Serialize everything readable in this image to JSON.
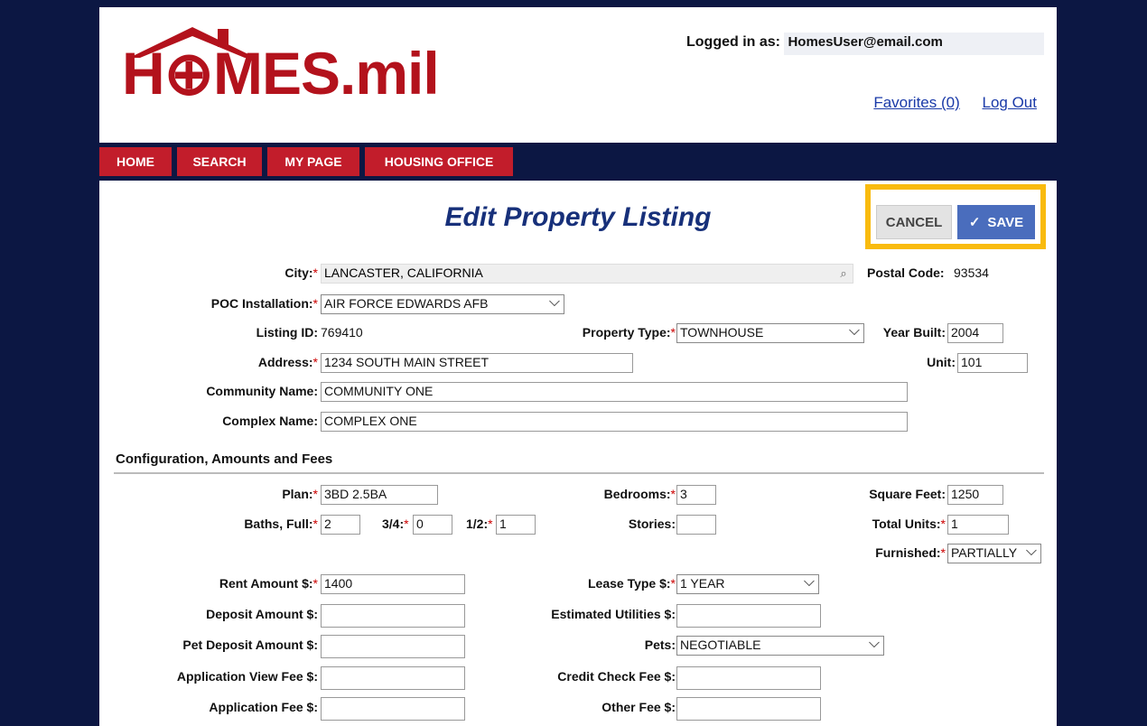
{
  "header": {
    "logo_text": "H⊕MES.mil",
    "logged_label": "Logged in as:",
    "user_email": "HomesUser@email.com",
    "favorites_link": "Favorites (0)",
    "logout_link": "Log Out"
  },
  "nav": [
    {
      "label": "HOME"
    },
    {
      "label": "SEARCH"
    },
    {
      "label": "MY PAGE"
    },
    {
      "label": "HOUSING OFFICE"
    }
  ],
  "page_title": "Edit Property Listing",
  "actions": {
    "cancel": "CANCEL",
    "save": "SAVE",
    "save_icon": "check-icon"
  },
  "form": {
    "city_label": "City:",
    "city_value": "LANCASTER, CALIFORNIA",
    "postal_label": "Postal Code:",
    "postal_value": "93534",
    "poc_label": "POC Installation:",
    "poc_value": "AIR FORCE EDWARDS AFB",
    "listing_label": "Listing ID:",
    "listing_value": "769410",
    "ptype_label": "Property Type:",
    "ptype_value": "TOWNHOUSE",
    "year_label": "Year Built:",
    "year_value": "2004",
    "address_label": "Address:",
    "address_value": "1234 SOUTH MAIN STREET",
    "unit_label": "Unit:",
    "unit_value": "101",
    "community_label": "Community Name:",
    "community_value": "COMMUNITY ONE",
    "complex_label": "Complex Name:",
    "complex_value": "COMPLEX ONE"
  },
  "config": {
    "section_title": "Configuration, Amounts and Fees",
    "plan_label": "Plan:",
    "plan_value": "3BD 2.5BA",
    "bedrooms_label": "Bedrooms:",
    "bedrooms_value": "3",
    "sqft_label": "Square Feet:",
    "sqft_value": "1250",
    "baths_label": "Baths, Full:",
    "baths_value": "2",
    "three_q_label": "3/4:",
    "three_q_value": "0",
    "half_label": "1/2:",
    "half_value": "1",
    "stories_label": "Stories:",
    "stories_value": "",
    "total_units_label": "Total Units:",
    "total_units_value": "1",
    "furnished_label": "Furnished:",
    "furnished_value": "PARTIALLY",
    "rent_label": "Rent Amount $:",
    "rent_value": "1400",
    "lease_label": "Lease Type $:",
    "lease_value": "1 YEAR",
    "deposit_label": "Deposit Amount $:",
    "deposit_value": "",
    "utilities_label": "Estimated Utilities $:",
    "utilities_value": "",
    "pet_deposit_label": "Pet Deposit Amount $:",
    "pet_deposit_value": "",
    "pets_label": "Pets:",
    "pets_value": "NEGOTIABLE",
    "app_view_label": "Application View Fee $:",
    "app_view_value": "",
    "credit_label": "Credit Check Fee $:",
    "credit_value": "",
    "app_fee_label": "Application Fee $:",
    "app_fee_value": "",
    "other_label": "Other Fee $:",
    "other_value": ""
  },
  "colors": {
    "brand_red": "#c21d2b",
    "navy": "#0c1743",
    "title_blue": "#17307a",
    "highlight": "#f9bb0e"
  }
}
